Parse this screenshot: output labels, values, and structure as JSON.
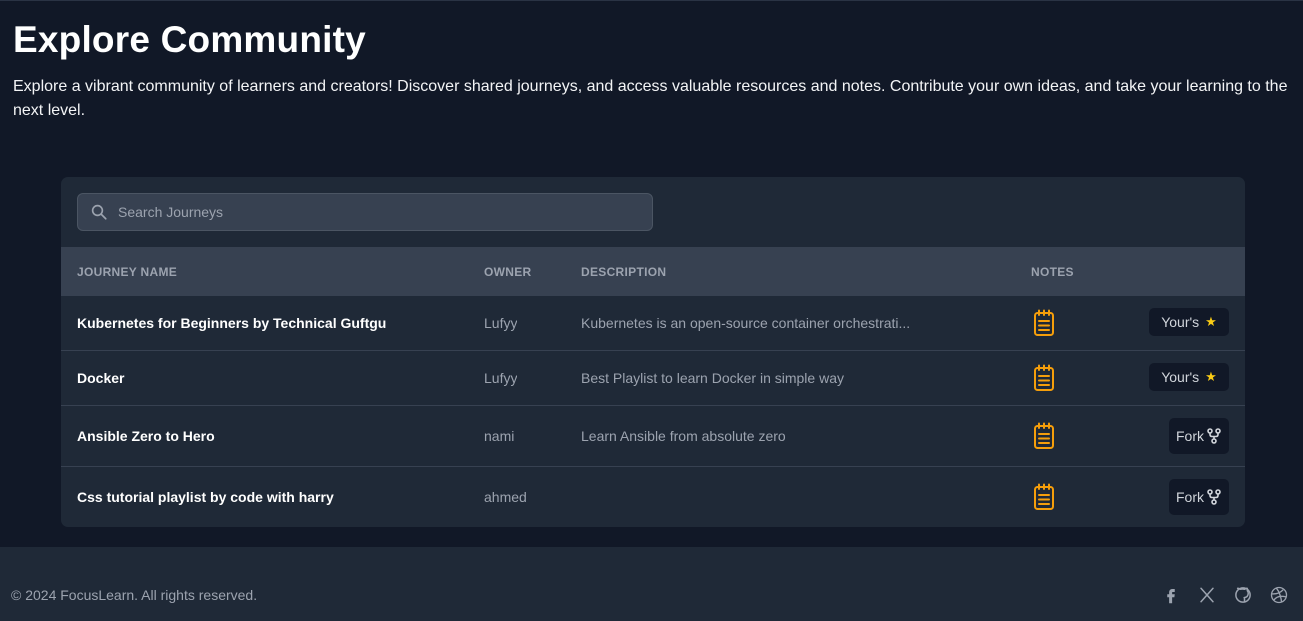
{
  "hero": {
    "title": "Explore Community",
    "description": "Explore a vibrant community of learners and creators! Discover shared journeys, and access valuable resources and notes. Contribute your own ideas, and take your learning to the next level."
  },
  "search": {
    "placeholder": "Search Journeys",
    "value": "",
    "icon": "search-icon"
  },
  "table": {
    "headers": {
      "name": "JOURNEY NAME",
      "owner": "OWNER",
      "description": "DESCRIPTION",
      "notes": "NOTES"
    },
    "rows": [
      {
        "name": "Kubernetes for Beginners by Technical Guftgu",
        "owner": "Lufyy",
        "description": "Kubernetes is an open-source container orchestrati...",
        "action": "Your's",
        "action_icon": "star-icon"
      },
      {
        "name": "Docker",
        "owner": "Lufyy",
        "description": "Best Playlist to learn Docker in simple way",
        "action": "Your's",
        "action_icon": "star-icon"
      },
      {
        "name": "Ansible Zero to Hero",
        "owner": "nami",
        "description": "Learn Ansible from absolute zero",
        "action": "Fork",
        "action_icon": "fork-icon"
      },
      {
        "name": "Css tutorial playlist by code with harry",
        "owner": "ahmed",
        "description": "",
        "action": "Fork",
        "action_icon": "fork-icon"
      }
    ],
    "notes_icon": "notepad-icon",
    "star_glyph": "★"
  },
  "footer": {
    "copyright": "© 2024 FocusLearn. All rights reserved.",
    "social_icons": [
      "facebook-icon",
      "x-icon",
      "github-icon",
      "dribbble-icon"
    ]
  },
  "colors": {
    "background": "#111827",
    "card": "#1f2937",
    "header_row": "#374151",
    "accent_orange": "#f59e0b",
    "star_yellow": "#facc15"
  }
}
